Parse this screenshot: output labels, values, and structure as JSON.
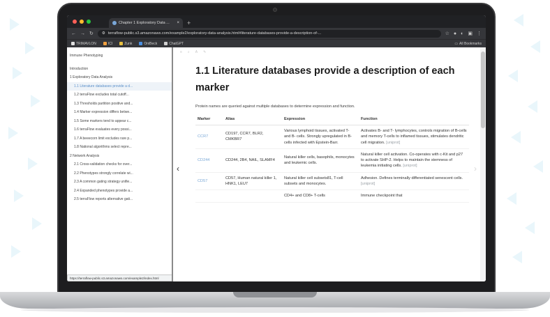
{
  "browser": {
    "tab_title": "Chapter 1 Exploratory Data ...",
    "tab_close": "×",
    "new_tab": "+",
    "url": "terraflow-public.s3.amazonaws.com/example2/exploratory-data-analysis.html#literature-databases-provide-a-description-of-...",
    "bookmarks": [
      {
        "label": "TRIMAVLON",
        "color": "#e0e0e0"
      },
      {
        "label": "ICI",
        "color": "#f0a040"
      },
      {
        "label": "Zunk",
        "color": "#e8c040"
      },
      {
        "label": "OniBeck",
        "color": "#4a8fe0"
      },
      {
        "label": "ChatGPT",
        "color": "#d0d0d0"
      }
    ],
    "bookmarks_right": "All Bookmarks"
  },
  "toc": {
    "items": [
      {
        "label": "Immune Phenotyping",
        "level": "top",
        "active": false
      },
      {
        "label": "Introduction",
        "level": "top",
        "active": false
      },
      {
        "label": "1 Exploratory Data Analysis",
        "level": "top",
        "active": false
      },
      {
        "label": "1.1 Literature databases provide a d...",
        "level": "sub",
        "active": true
      },
      {
        "label": "1.2 terraFlow excludes total cutoff...",
        "level": "sub",
        "active": false
      },
      {
        "label": "1.3 Thresholds partition positive and...",
        "level": "sub",
        "active": false
      },
      {
        "label": "1.4 Marker expression differs betwe...",
        "level": "sub",
        "active": false
      },
      {
        "label": "1.5 Some markers tend to appear c...",
        "level": "sub",
        "active": false
      },
      {
        "label": "1.6 terraFlow evaluates every possi...",
        "level": "sub",
        "active": false
      },
      {
        "label": "1.7 A beeecorn limit excludes rare p...",
        "level": "sub",
        "active": false
      },
      {
        "label": "1.8 National algorithms select repre...",
        "level": "sub",
        "active": false
      },
      {
        "label": "2 Network Analysis",
        "level": "top",
        "active": false
      },
      {
        "label": "2.1 Cross-validation checks for over...",
        "level": "sub",
        "active": false
      },
      {
        "label": "2.2 Phenotypes strongly correlate wi...",
        "level": "sub",
        "active": false
      },
      {
        "label": "2.3 A common gating strategy unifie...",
        "level": "sub",
        "active": false
      },
      {
        "label": "2.4 Expanded phenotypes provide a...",
        "level": "sub",
        "active": false
      },
      {
        "label": "2.5 terraFlow reports alternative gati...",
        "level": "sub",
        "active": false
      }
    ],
    "status_url": "https://terraflow-public.s3.amazonaws.com/example2/index.html"
  },
  "content": {
    "heading": "1.1  Literature databases provide a description of each marker",
    "intro": "Protein names are queried against multiple databases to determine expression and function.",
    "nav_prev": "‹",
    "nav_next": "›",
    "table": {
      "headers": [
        "Marker",
        "Alias",
        "Expression",
        "Function"
      ],
      "rows": [
        {
          "marker": "CCR7",
          "alias": "CD197, CCR7, BLR2, CMKBR7",
          "expression": "Various lymphoid tissues, activated T- and B- cells. Strongly upregulated in B-cells infected with Epstein-Barr.",
          "function": "Activates B- and T- lymphocytes, controls migration of B-cells and memory T-cells to inflamed tissues, stimulates dendritic cell migration.",
          "source": "[uniprot]"
        },
        {
          "marker": "CD244",
          "alias": "CD244, 2B4, NAIL, SLAMF4",
          "expression": "Natural killer cells, basophils, monocytes and leukemic cells.",
          "function": "Natural killer cell activation. Co-operates with c-Kit and p27 to activate SHP-2. Helps to maintain the stemness of leukemia initiating cells.",
          "source": "[uniprot]"
        },
        {
          "marker": "CD57",
          "alias": "CD57, Human natural killer 1, HNK1, LEU7",
          "expression": "Natural killer cell subsets81, T-cell subsets and monocytes.",
          "function": "Adhesion. Defines terminally differentiated senescent cells.",
          "source": "[uniprot]"
        },
        {
          "marker": "",
          "alias": "",
          "expression": "CD4+ and CD8+ T-cells",
          "function": "Immune checkpoint that",
          "source": ""
        }
      ]
    }
  }
}
